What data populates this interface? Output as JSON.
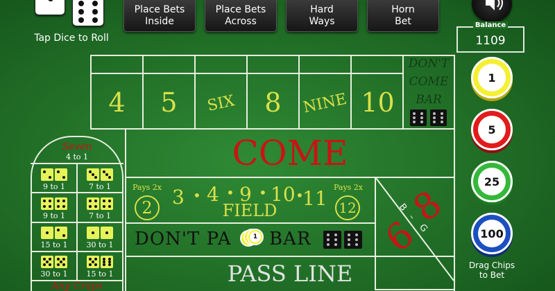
{
  "dice": {
    "label": "Tap Dice to Roll",
    "die1": 1,
    "die2": 6
  },
  "top_buttons": [
    {
      "label": "Place Bets\nInside"
    },
    {
      "label": "Place Bets\nAcross"
    },
    {
      "label": "Hard\nWays"
    },
    {
      "label": "Horn\nBet"
    }
  ],
  "sound_icon": "speaker-icon",
  "balance": {
    "title": "Balance",
    "value": "1109"
  },
  "chips": [
    {
      "value": "1",
      "color": "#f5ef33"
    },
    {
      "value": "5",
      "color": "#e01c1c"
    },
    {
      "value": "25",
      "color": "#35b83a"
    },
    {
      "value": "100",
      "color": "#1c4fc0"
    }
  ],
  "drag_label": "Drag Chips\nto Bet",
  "place_numbers": [
    "4",
    "5",
    "SIX",
    "8",
    "NINE",
    "10"
  ],
  "dont_come_bar": {
    "line1": "DON'T",
    "line2": "COME",
    "line3": "BAR"
  },
  "come": "COME",
  "field": {
    "numbers": [
      "3",
      "4",
      "9",
      "10",
      "11"
    ],
    "label": "FIELD",
    "pays_left": "Pays 2x",
    "pays_left_num": "2",
    "pays_right": "Pays 2x",
    "pays_right_num": "12"
  },
  "big68": {
    "big": "B",
    "g": "G",
    "six": "6",
    "eight": "8",
    "dash": "–"
  },
  "dont_pass": {
    "part1": "DON'T PA",
    "part2": "BAR",
    "chip_value": "1"
  },
  "pass_line": "PASS LINE",
  "props": {
    "seven_title": "Seven",
    "seven_odds": "4 to 1",
    "any_craps": "Any Craps",
    "cells": [
      {
        "odds": "9 to 1",
        "d1": 2,
        "d2": 2
      },
      {
        "odds": "7 to 1",
        "d1": 3,
        "d2": 3
      },
      {
        "odds": "9 to 1",
        "d1": 4,
        "d2": 4
      },
      {
        "odds": "7 to 1",
        "d1": 4,
        "d2": 4
      },
      {
        "odds": "15 to 1",
        "d1": 1,
        "d2": 2
      },
      {
        "odds": "30 to 1",
        "d1": 1,
        "d2": 1
      },
      {
        "odds": "30 to 1",
        "d1": 5,
        "d2": 6
      },
      {
        "odds": "15 to 1",
        "d1": 5,
        "d2": 6
      }
    ]
  }
}
